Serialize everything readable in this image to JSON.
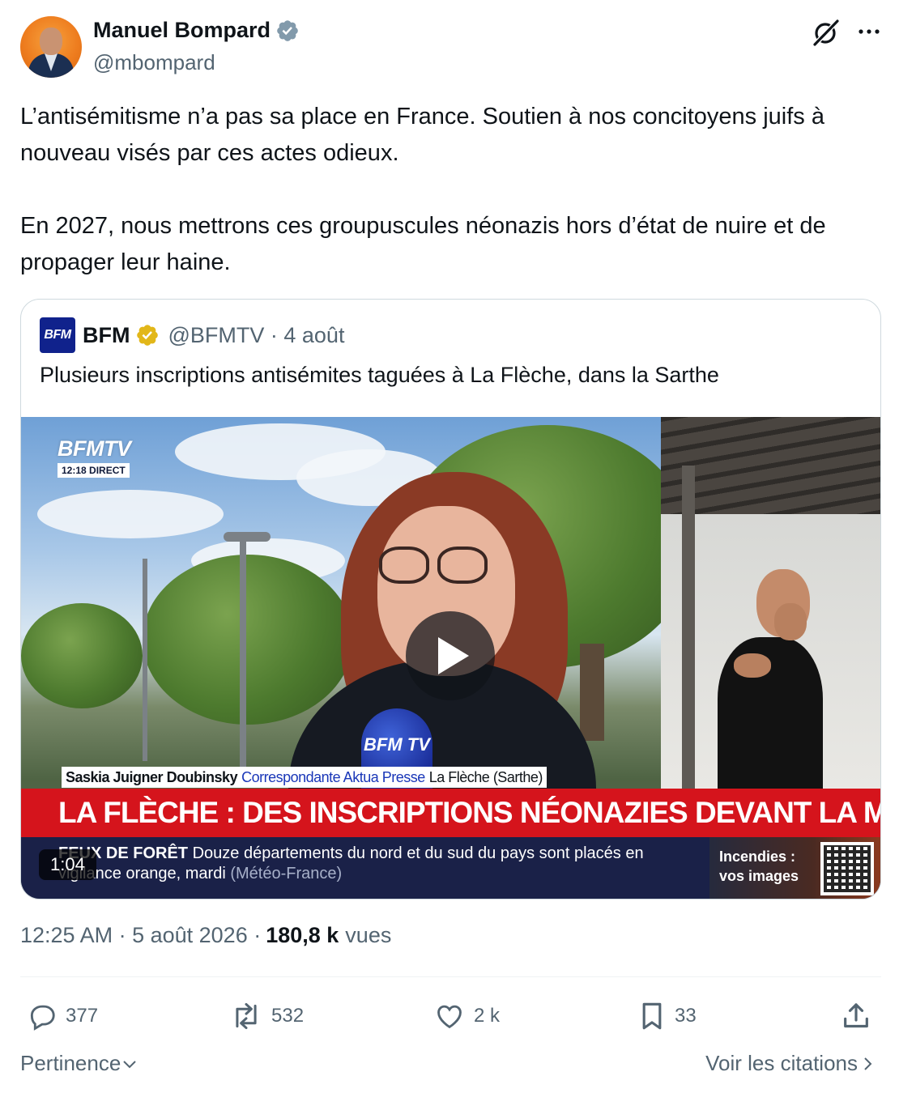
{
  "author": {
    "name": "Manuel Bompard",
    "handle": "@mbompard"
  },
  "tweet": {
    "paragraph1": "L’antisémitisme n’a pas sa place en France. Soutien à nos concitoyens juifs à nouveau visés par ces actes odieux.",
    "paragraph2": "En 2027, nous mettrons ces groupuscules néonazis hors d’état de nuire et de propager leur haine."
  },
  "quoted": {
    "logo_text": "BFM",
    "name": "BFM",
    "meta": "@BFMTV · 4 août",
    "text": "Plusieurs inscriptions antisémites taguées à La Flèche, dans la Sarthe",
    "video": {
      "channel_logo": "BFMTV",
      "time_live": "12:18  DIRECT",
      "mic_label": "BFM TV",
      "lower_third_name": "Saskia Juigner Doubinsky",
      "lower_third_role": "Correspondante Aktua Presse",
      "lower_third_place": "La Flèche (Sarthe)",
      "headline": "LA FLÈCHE : DES INSCRIPTIONS NÉONAZIES DEVANT LA MAIRIE",
      "ticker_keyword": "FEUX DE FORÊT",
      "ticker_text": "Douze départements du nord et du sud du pays sont placés en vigilance orange, mardi",
      "ticker_source": "(Météo-France)",
      "promo_line1": "Incendies :",
      "promo_line2": "vos images",
      "duration": "1:04"
    }
  },
  "timestamp": {
    "time_date": "12:25 AM · 5 août 2026 ·",
    "views_count": "180,8 k",
    "views_label": "vues"
  },
  "actions": {
    "replies": "377",
    "reposts": "532",
    "likes": "2 k",
    "bookmarks": "33"
  },
  "footer": {
    "sort_label": "Pertinence",
    "quotes_link": "Voir les citations"
  },
  "colors": {
    "verified_blue": "#829aab",
    "verified_gold": "#e2b719",
    "headline_red": "#d5141c",
    "ticker_navy": "#1a2148",
    "muted_text": "#536471"
  },
  "icons": [
    "verified-badge-icon",
    "grok-icon",
    "more-icon",
    "play-icon",
    "reply-icon",
    "repost-icon",
    "like-icon",
    "bookmark-icon",
    "share-icon",
    "chevron-down-icon",
    "chevron-right-icon"
  ]
}
